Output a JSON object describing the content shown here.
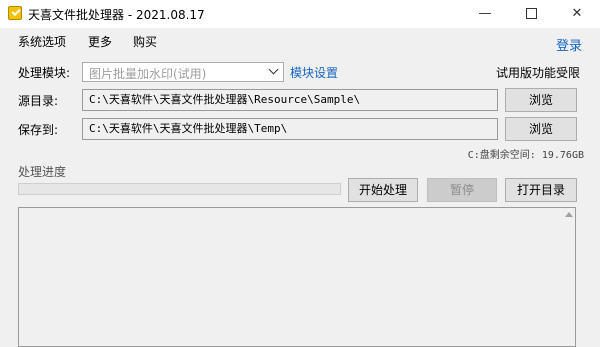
{
  "window": {
    "title": "天喜文件批处理器 - 2021.08.17",
    "minimize_glyph": "—",
    "close_glyph": "✕"
  },
  "menu": {
    "items": [
      "系统选项",
      "更多",
      "购买"
    ],
    "login": "登录"
  },
  "form": {
    "module_label": "处理模块:",
    "module_value": "图片批量加水印(试用)",
    "module_settings": "模块设置",
    "trial_notice": "试用版功能受限",
    "source_label": "源目录:",
    "source_value": "C:\\天喜软件\\天喜文件批处理器\\Resource\\Sample\\",
    "save_label": "保存到:",
    "save_value": "C:\\天喜软件\\天喜文件批处理器\\Temp\\",
    "browse": "浏览",
    "disk_space": "C:盘剩余空间: 19.76GB"
  },
  "progress": {
    "label": "处理进度",
    "value": 0
  },
  "actions": {
    "start": "开始处理",
    "pause": "暂停",
    "open_dir": "打开目录"
  }
}
